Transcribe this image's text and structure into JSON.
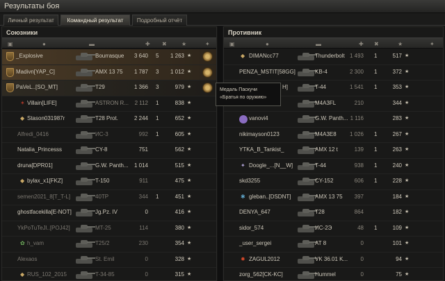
{
  "window": {
    "title": "Результаты боя"
  },
  "tabs": [
    "Личный результат",
    "Командный результат",
    "Подробный отчёт"
  ],
  "allies": {
    "title": "Союзники",
    "rows": [
      {
        "player": "_Explosive",
        "vehicle": "Bourrasque",
        "damage": "3 640",
        "kills": "5",
        "xp": "1 263",
        "medal": true
      },
      {
        "player": "Madivn[YAP_C]",
        "vehicle": "AMX 13 75",
        "damage": "1 787",
        "kills": "3",
        "xp": "1 012",
        "medal": true
      },
      {
        "player": "PaVeL..[SO_MT]",
        "vehicle": "T29",
        "damage": "1 366",
        "kills": "3",
        "xp": "979",
        "medal": true
      },
      {
        "player": "Villain[LIFE]",
        "vehicle": "ASTRON R...",
        "damage": "2 112",
        "kills": "1",
        "xp": "838"
      },
      {
        "player": "Stason031987r",
        "vehicle": "T28 Prot.",
        "damage": "2 244",
        "kills": "1",
        "xp": "652"
      },
      {
        "player": "Alfredi_0416",
        "vehicle": "ИС-3",
        "damage": "992",
        "kills": "1",
        "xp": "605"
      },
      {
        "player": "Natalia_Princesss",
        "vehicle": "CY-8",
        "damage": "751",
        "kills": "",
        "xp": "562"
      },
      {
        "player": "druna[DPR01]",
        "vehicle": "G.W. Panth...",
        "damage": "1 014",
        "kills": "",
        "xp": "515"
      },
      {
        "player": "bylax_x1[FKZ]",
        "vehicle": "T-150",
        "damage": "911",
        "kills": "",
        "xp": "475"
      },
      {
        "player": "semen2021_8[T_T-L]",
        "vehicle": "40TP",
        "damage": "344",
        "kills": "1",
        "xp": "451"
      },
      {
        "player": "ghostfacekilla[E-NOT]",
        "vehicle": "Jg.Pz. IV",
        "damage": "0",
        "kills": "",
        "xp": "416"
      },
      {
        "player": "YkPoTuTeJl..[POJ42]",
        "vehicle": "MT-25",
        "damage": "114",
        "kills": "",
        "xp": "380"
      },
      {
        "player": "h_vam",
        "vehicle": "T25/2",
        "damage": "230",
        "kills": "",
        "xp": "354"
      },
      {
        "player": "Alexaos",
        "vehicle": "St. Emil",
        "damage": "0",
        "kills": "",
        "xp": "328"
      },
      {
        "player": "RUS_102_2015",
        "vehicle": "T-34-85",
        "damage": "0",
        "kills": "",
        "xp": "315"
      }
    ]
  },
  "enemies": {
    "title": "Противник",
    "rows": [
      {
        "player": "DIMANcc77",
        "vehicle": "Thunderbolt",
        "damage": "1 493",
        "kills": "1",
        "xp": "517"
      },
      {
        "player": "PENZA_MSTIT[58GG]",
        "vehicle": "KB-4",
        "damage": "2 300",
        "kills": "1",
        "xp": "372"
      },
      {
        "player": "H]",
        "vehicle": "T-44",
        "damage": "1 541",
        "kills": "1",
        "xp": "353"
      },
      {
        "player": "",
        "vehicle": "M4A3FL",
        "damage": "210",
        "kills": "",
        "xp": "344"
      },
      {
        "player": "vanovi4",
        "vehicle": "G.W. Panth...",
        "damage": "1 116",
        "kills": "",
        "xp": "283"
      },
      {
        "player": "nikimayson0123",
        "vehicle": "M4A3E8",
        "damage": "1 026",
        "kills": "1",
        "xp": "267"
      },
      {
        "player": "YTKA_B_Tankist_",
        "vehicle": "AMX 12 t",
        "damage": "139",
        "kills": "1",
        "xp": "263"
      },
      {
        "player": "Doogle_...[N__W]",
        "vehicle": "T-44",
        "damage": "938",
        "kills": "1",
        "xp": "240"
      },
      {
        "player": "skd3255",
        "vehicle": "CY-152",
        "damage": "606",
        "kills": "1",
        "xp": "228"
      },
      {
        "player": "gleban..[DSDNT]",
        "vehicle": "AMX 13 75",
        "damage": "397",
        "kills": "",
        "xp": "184"
      },
      {
        "player": "DENYA_647",
        "vehicle": "T28",
        "damage": "864",
        "kills": "",
        "xp": "182"
      },
      {
        "player": "sidor_574",
        "vehicle": "ИС-2Э",
        "damage": "48",
        "kills": "1",
        "xp": "109"
      },
      {
        "player": "_user_sergei",
        "vehicle": "AT 8",
        "damage": "0",
        "kills": "",
        "xp": "101"
      },
      {
        "player": "ZAGUL2012",
        "vehicle": "VK 36.01 K...",
        "damage": "0",
        "kills": "",
        "xp": "94"
      },
      {
        "player": "zorg_562[CK-KC]",
        "vehicle": "Hummel",
        "damage": "0",
        "kills": "",
        "xp": "75"
      }
    ]
  },
  "tooltip": {
    "line1": "Медаль Паскучи",
    "line2": "«Братья по оружию»"
  },
  "colors": {
    "own_row": "#4a3a26",
    "panel_bg": "#191918",
    "text": "#cfc9bb"
  }
}
